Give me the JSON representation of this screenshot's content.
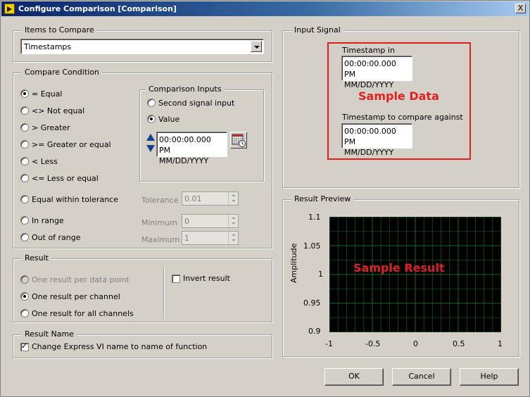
{
  "window": {
    "title": "Configure Comparison [Comparison]",
    "close_label": "X"
  },
  "items_to_compare": {
    "title": "Items to Compare",
    "selected": "Timestamps"
  },
  "compare_condition": {
    "title": "Compare Condition",
    "options": [
      {
        "label": "= Equal",
        "selected": true
      },
      {
        "label": "<> Not equal",
        "selected": false
      },
      {
        "label": "> Greater",
        "selected": false
      },
      {
        "label": ">= Greater or equal",
        "selected": false
      },
      {
        "label": "< Less",
        "selected": false
      },
      {
        "label": "<= Less or equal",
        "selected": false
      },
      {
        "label": "Equal within tolerance",
        "selected": false
      },
      {
        "label": "In range",
        "selected": false
      },
      {
        "label": "Out of range",
        "selected": false
      }
    ],
    "tolerance": {
      "label": "Tolerance",
      "value": "0.01"
    },
    "minimum": {
      "label": "Minimum",
      "value": "0"
    },
    "maximum": {
      "label": "Maximum",
      "value": "1"
    }
  },
  "comparison_inputs": {
    "title": "Comparison Inputs",
    "second_signal_label": "Second signal input",
    "value_label": "Value",
    "value_selected": true,
    "timestamp_time": "00:00:00.000 PM",
    "timestamp_date": "MM/DD/YYYY"
  },
  "result": {
    "title": "Result",
    "options": [
      {
        "label": "One result per data point",
        "selected": false,
        "disabled": true
      },
      {
        "label": "One result per channel",
        "selected": true,
        "disabled": false
      },
      {
        "label": "One result for all channels",
        "selected": false,
        "disabled": false
      }
    ],
    "invert_label": "Invert result",
    "invert_checked": false
  },
  "result_name": {
    "title": "Result Name",
    "change_name_label": "Change Express VI name to name of function",
    "change_name_checked": true
  },
  "input_signal": {
    "title": "Input Signal",
    "timestamp_in_label": "Timestamp in",
    "timestamp_in_time": "00:00:00.000 PM",
    "timestamp_in_date": "MM/DD/YYYY",
    "sample_data_label": "Sample Data",
    "compare_against_label": "Timestamp to compare against",
    "compare_time": "00:00:00.000 PM",
    "compare_date": "MM/DD/YYYY"
  },
  "result_preview": {
    "title": "Result Preview",
    "sample_result_label": "Sample Result"
  },
  "chart_data": {
    "type": "line",
    "title": "",
    "xlabel": "",
    "ylabel": "Amplitude",
    "xlim": [
      -1,
      1
    ],
    "ylim": [
      0.9,
      1.1
    ],
    "x_ticks": [
      "-1",
      "-0.5",
      "0",
      "0.5",
      "1"
    ],
    "y_ticks": [
      "1.1",
      "1.05",
      "1",
      "0.95",
      "0.9"
    ],
    "grid": true,
    "background": "#000000",
    "grid_color": "#0f6a2a",
    "series": []
  },
  "buttons": {
    "ok": "OK",
    "cancel": "Cancel",
    "help": "Help"
  },
  "colors": {
    "accent_red": "#e02020",
    "dialog_bg": "#d4d0c8"
  }
}
